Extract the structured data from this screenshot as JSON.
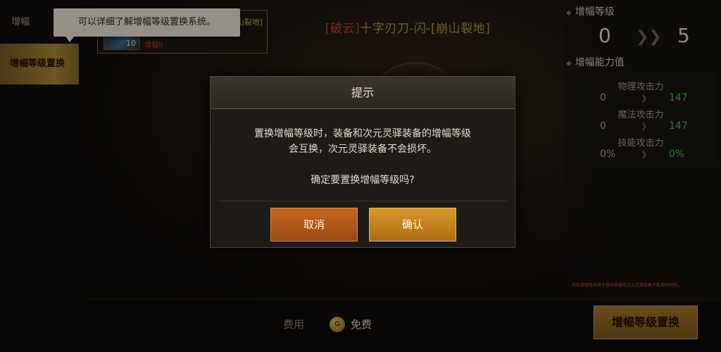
{
  "left_tabs": {
    "amplify": "增幅",
    "amp_level_swap": "增幅等级置换"
  },
  "tooltip": {
    "text": "可以详细了解增幅等级置换系统。"
  },
  "item": {
    "name_tail": "崩山裂地]",
    "level": "10",
    "amp": "增幅0"
  },
  "equipment": {
    "title_rarity": "[破云]",
    "title_name": "十字刃刀-闪-[崩山裂地]"
  },
  "amp_level": {
    "header": "增幅等级",
    "from": "0",
    "to": "5",
    "arrow": "❯❯"
  },
  "amp_stats": {
    "header": "增幅能力值",
    "rows": [
      {
        "label": "物理攻击力",
        "from": "0",
        "to": "147"
      },
      {
        "label": "魔法攻击力",
        "from": "0",
        "to": "147"
      },
      {
        "label": "技能攻击力",
        "from": "0%",
        "to": "0%"
      }
    ]
  },
  "note": "只有增幅等级高于目标装备的次元灵驿装备才能用作材料。",
  "cost": {
    "label": "费用",
    "value": "免费",
    "coin_glyph": "G"
  },
  "swap_button": "增幅等级置换",
  "dialog": {
    "title": "提示",
    "line1": "置换增幅等级时，装备和次元灵驿装备的增幅等级",
    "line2": "会互换，次元灵驿装备不会损坏。",
    "question": "确定要置换增幅等级吗?",
    "cancel": "取消",
    "confirm": "确认"
  },
  "colors": {
    "accent_gold": "#b38a3a",
    "cancel_orange": "#c8661c",
    "confirm_gold": "#d9962a",
    "stat_green": "#4fbf5b",
    "rarity_red": "#c4453a"
  }
}
